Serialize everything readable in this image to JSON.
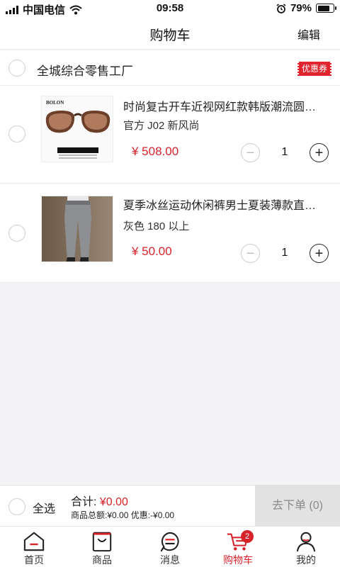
{
  "status_bar": {
    "carrier": "中国电信",
    "time": "09:58",
    "battery": "79%",
    "battery_level": 0.79
  },
  "nav": {
    "title": "购物车",
    "edit_label": "编辑"
  },
  "store": {
    "name": "全城综合零售工厂",
    "coupon_label": "优惠券"
  },
  "items": [
    {
      "title": "时尚复古开车近视网红款韩版潮流圆脸太阳镜",
      "spec": "官方 J02 新风尚",
      "price": "¥ 508.00",
      "quantity": "1",
      "brand": "BOLON"
    },
    {
      "title": "夏季冰丝运动休闲裤男士夏装薄款直筒长裤子",
      "spec": "灰色 180 以上",
      "price": "¥ 50.00",
      "quantity": "1"
    }
  ],
  "footer": {
    "select_all_label": "全选",
    "total_label": "合计:",
    "total_value": "¥0.00",
    "detail": "商品总额:¥0.00 优惠:-¥0.00",
    "checkout_label": "去下单 (0)"
  },
  "tabs": [
    {
      "label": "首页",
      "icon": "home-icon"
    },
    {
      "label": "商品",
      "icon": "bag-icon"
    },
    {
      "label": "消息",
      "icon": "message-icon"
    },
    {
      "label": "购物车",
      "icon": "cart-icon",
      "badge": "2",
      "active": true
    },
    {
      "label": "我的",
      "icon": "user-icon"
    }
  ],
  "colors": {
    "accent": "#d8232a",
    "background": "#f4f4f6"
  }
}
